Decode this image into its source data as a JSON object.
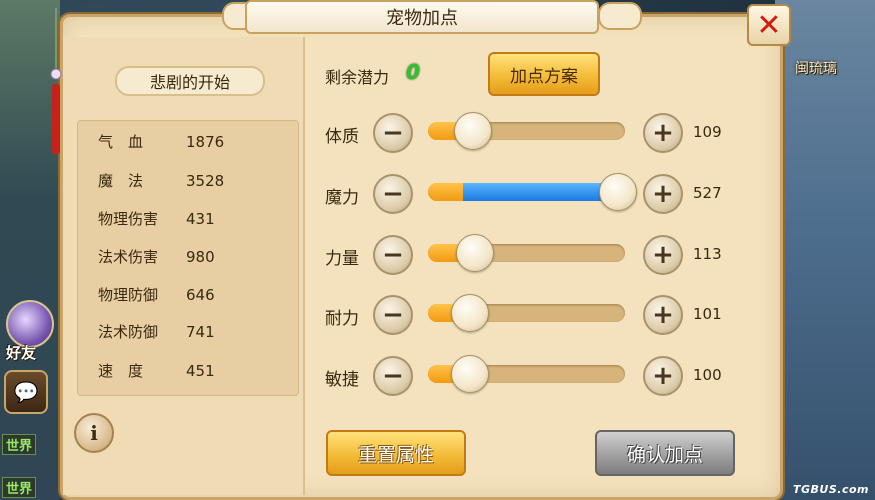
{
  "header": {
    "title": "宠物加点"
  },
  "background": {
    "right_text": "闽琉璃",
    "friend_label": "好友",
    "world_tags": [
      "世界",
      "世界"
    ],
    "watermark": "TGBUS.com"
  },
  "pet": {
    "name": "悲剧的开始"
  },
  "stats": [
    {
      "label": "气　血",
      "value": "1876"
    },
    {
      "label": "魔　法",
      "value": "3528"
    },
    {
      "label": "物理伤害",
      "value": "431"
    },
    {
      "label": "法术伤害",
      "value": "980"
    },
    {
      "label": "物理防御",
      "value": "646"
    },
    {
      "label": "法术防御",
      "value": "741"
    },
    {
      "label": "速　度",
      "value": "451"
    }
  ],
  "potential": {
    "label": "剩余潜力",
    "value": "0"
  },
  "buttons": {
    "plan": "加点方案",
    "reset": "重置属性",
    "confirm": "确认加点",
    "info": "i",
    "close": "✕"
  },
  "attributes": [
    {
      "label": "体质",
      "value": "109",
      "fill": 0.2,
      "mode": "orange"
    },
    {
      "label": "魔力",
      "value": "527",
      "fill": 1.0,
      "mode": "blue"
    },
    {
      "label": "力量",
      "value": "113",
      "fill": 0.21,
      "mode": "orange"
    },
    {
      "label": "耐力",
      "value": "101",
      "fill": 0.18,
      "mode": "orange"
    },
    {
      "label": "敏捷",
      "value": "100",
      "fill": 0.18,
      "mode": "orange"
    }
  ],
  "colors": {
    "potential": "#2fc12f",
    "gold_button": "#f2b935",
    "gray_button": "#9c9c9c",
    "close_x": "#d01b14",
    "blue_fill": "#1a7ae0",
    "orange_fill": "#f39a12"
  }
}
